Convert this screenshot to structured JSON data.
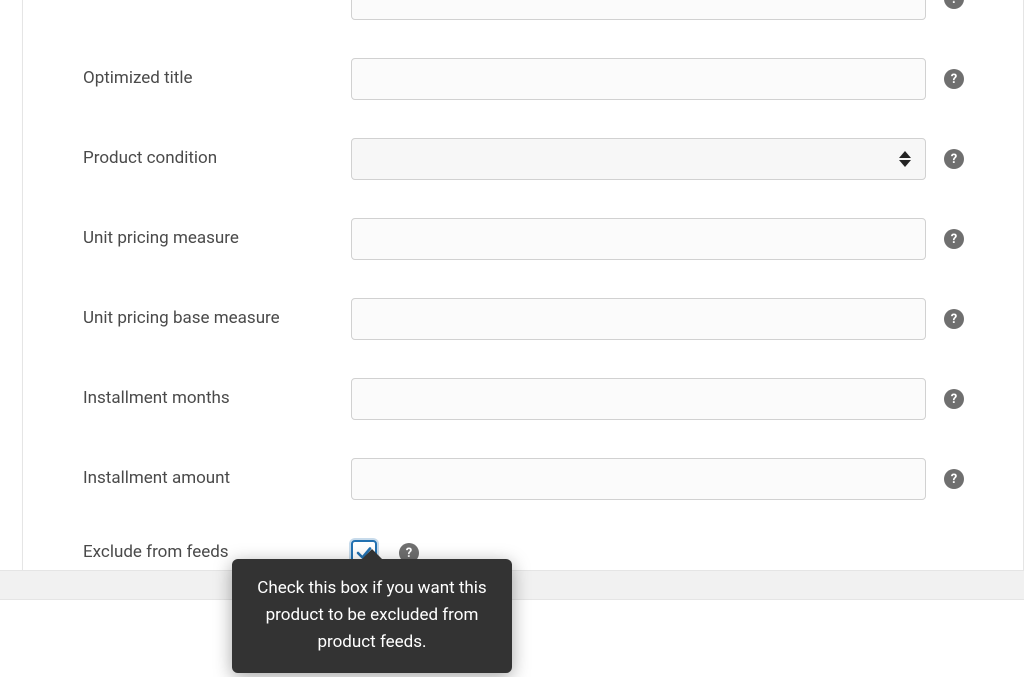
{
  "fields": {
    "top_unlabeled": {
      "label": "",
      "value": ""
    },
    "optimized_title": {
      "label": "Optimized title",
      "value": ""
    },
    "product_condition": {
      "label": "Product condition",
      "value": ""
    },
    "unit_pricing_measure": {
      "label": "Unit pricing measure",
      "value": ""
    },
    "unit_pricing_base_measure": {
      "label": "Unit pricing base measure",
      "value": ""
    },
    "installment_months": {
      "label": "Installment months",
      "value": ""
    },
    "installment_amount": {
      "label": "Installment amount",
      "value": ""
    },
    "exclude_from_feeds": {
      "label": "Exclude from feeds",
      "checked": true
    }
  },
  "tooltips": {
    "exclude_from_feeds": "Check this box if you want this product to be excluded from product feeds."
  },
  "icons": {
    "help_glyph": "?"
  }
}
